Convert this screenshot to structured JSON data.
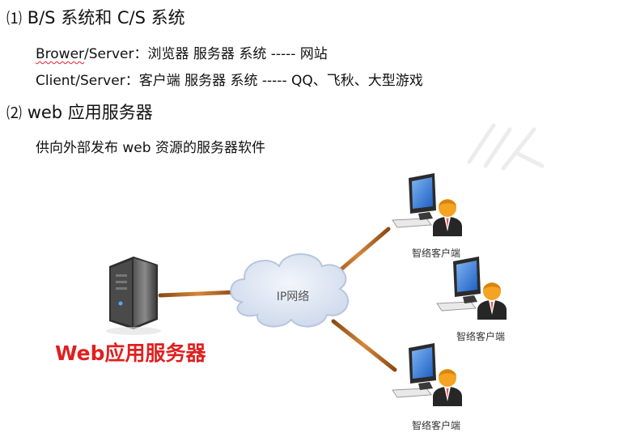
{
  "section1": {
    "num": "⑴",
    "title": "B/S 系统和 C/S 系统",
    "bs_term": "Brower",
    "bs_rest": "/Server：浏览器 服务器 系统 ----- 网站",
    "cs_line": "Client/Server：客户端 服务器 系统 ----- QQ、飞秋、大型游戏"
  },
  "section2": {
    "num": "⑵",
    "title": "web 应用服务器",
    "desc": "供向外部发布 web 资源的服务器软件"
  },
  "diagram": {
    "server_label": "Web应用服务器",
    "cloud_label": "IP网络",
    "client_label": "智络客户端"
  },
  "colors": {
    "link": "#b8641e",
    "server_label": "#e02020",
    "cloud": "#dfe7f3",
    "monitor": "#2a6fcf",
    "avatar_face": "#f4a322",
    "avatar_suit": "#2a2a2a"
  }
}
